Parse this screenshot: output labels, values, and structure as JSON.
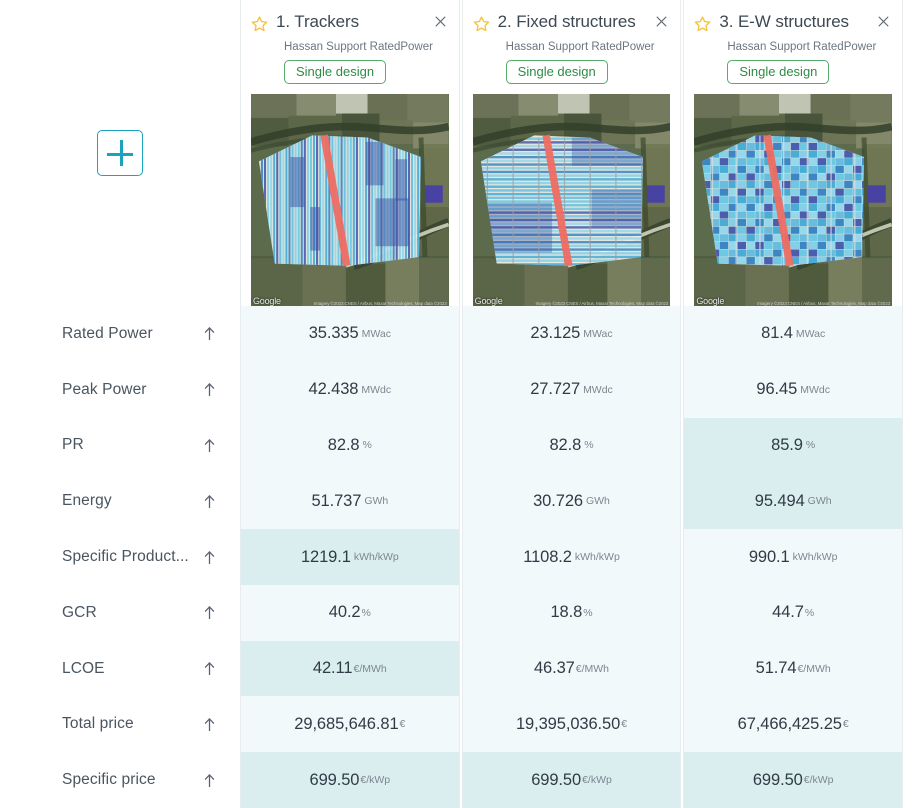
{
  "add_design": {
    "name": "add-design-button",
    "label": "+"
  },
  "metrics": [
    {
      "key": "rated_power",
      "label": "Rated Power"
    },
    {
      "key": "peak_power",
      "label": "Peak Power"
    },
    {
      "key": "pr",
      "label": "PR"
    },
    {
      "key": "energy",
      "label": "Energy"
    },
    {
      "key": "specific_production",
      "label": "Specific Product..."
    },
    {
      "key": "gcr",
      "label": "GCR"
    },
    {
      "key": "lcoe",
      "label": "LCOE"
    },
    {
      "key": "total_price",
      "label": "Total price"
    },
    {
      "key": "specific_price",
      "label": "Specific price"
    }
  ],
  "sort_arrow_glyph": "↑",
  "close_glyph": "✕",
  "colors": {
    "accent": "#1aa3bd",
    "star": "#f5c542",
    "badge_text": "#2e8b45",
    "badge_border": "#57ab6b",
    "cell_base": "#f2f9fb",
    "cell_best": "#daeef0",
    "label_text": "#4a5560"
  },
  "designs": [
    {
      "title": "1. Trackers",
      "subtitle": "Hassan Support RatedPower",
      "badge": "Single design",
      "favorite": true,
      "map_watermark": "Google",
      "map_attribution": "Imagery ©2023 CNES / Airbus, Maxar Technologies, Map data ©2023",
      "layout": "trackers",
      "values": [
        {
          "num": "35.335",
          "unit": "MWac",
          "best": false
        },
        {
          "num": "42.438",
          "unit": "MWdc",
          "best": false
        },
        {
          "num": "82.8",
          "unit": "%",
          "best": false
        },
        {
          "num": "51.737",
          "unit": "GWh",
          "best": false
        },
        {
          "num": "1219.1",
          "unit": "kWh/kWp",
          "best": true
        },
        {
          "num": "40.2",
          "unit": "%",
          "best": false,
          "tight": true
        },
        {
          "num": "42.11",
          "unit": "€/MWh",
          "best": true,
          "tight": true
        },
        {
          "num": "29,685,646.81",
          "unit": "€",
          "best": false,
          "tight": true
        },
        {
          "num": "699.50",
          "unit": "€/kWp",
          "best": true,
          "tight": true
        }
      ]
    },
    {
      "title": "2. Fixed structures",
      "subtitle": "Hassan Support RatedPower",
      "badge": "Single design",
      "favorite": true,
      "map_watermark": "Google",
      "map_attribution": "Imagery ©2023 CNES / Airbus, Maxar Technologies, Map data ©2023",
      "layout": "fixed",
      "values": [
        {
          "num": "23.125",
          "unit": "MWac",
          "best": false
        },
        {
          "num": "27.727",
          "unit": "MWdc",
          "best": false
        },
        {
          "num": "82.8",
          "unit": "%",
          "best": false
        },
        {
          "num": "30.726",
          "unit": "GWh",
          "best": false
        },
        {
          "num": "1108.2",
          "unit": "kWh/kWp",
          "best": false
        },
        {
          "num": "18.8",
          "unit": "%",
          "best": false,
          "tight": true
        },
        {
          "num": "46.37",
          "unit": "€/MWh",
          "best": false,
          "tight": true
        },
        {
          "num": "19,395,036.50",
          "unit": "€",
          "best": false,
          "tight": true
        },
        {
          "num": "699.50",
          "unit": "€/kWp",
          "best": true,
          "tight": true
        }
      ]
    },
    {
      "title": "3. E-W structures",
      "subtitle": "Hassan Support RatedPower",
      "badge": "Single design",
      "favorite": true,
      "map_watermark": "Google",
      "map_attribution": "Imagery ©2023 CNES / Airbus, Maxar Technologies, Map data ©2023",
      "layout": "ew",
      "values": [
        {
          "num": "81.4",
          "unit": "MWac",
          "best": false
        },
        {
          "num": "96.45",
          "unit": "MWdc",
          "best": false
        },
        {
          "num": "85.9",
          "unit": "%",
          "best": true
        },
        {
          "num": "95.494",
          "unit": "GWh",
          "best": true
        },
        {
          "num": "990.1",
          "unit": "kWh/kWp",
          "best": false
        },
        {
          "num": "44.7",
          "unit": "%",
          "best": false,
          "tight": true
        },
        {
          "num": "51.74",
          "unit": "€/MWh",
          "best": false,
          "tight": true
        },
        {
          "num": "67,466,425.25",
          "unit": "€",
          "best": false,
          "tight": true
        },
        {
          "num": "699.50",
          "unit": "€/kWp",
          "best": true,
          "tight": true
        }
      ]
    }
  ]
}
